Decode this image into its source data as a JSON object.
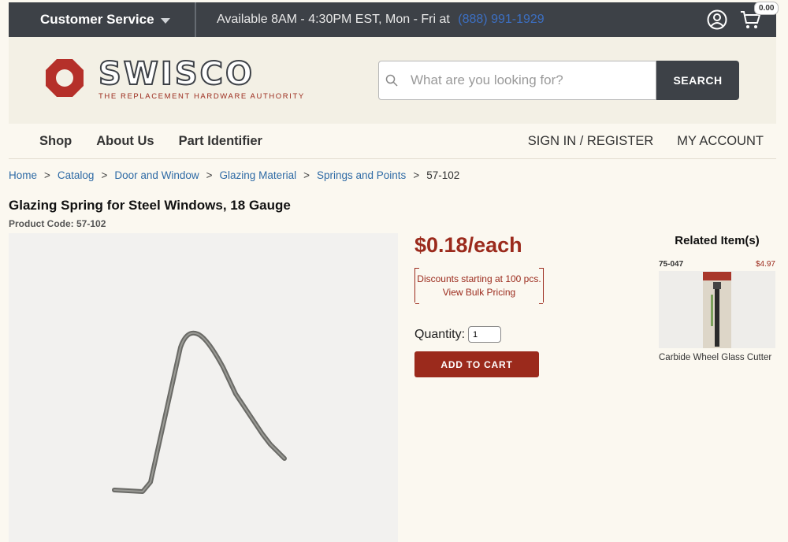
{
  "topbar": {
    "customer_service": "Customer Service",
    "hours": "Available 8AM - 4:30PM EST, Mon - Fri at",
    "phone": "(888) 991-1929",
    "cart_count": "0.00"
  },
  "header": {
    "logo_name": "SWISCO",
    "logo_tagline": "THE REPLACEMENT HARDWARE AUTHORITY",
    "search_placeholder": "What are you looking for?",
    "search_button": "SEARCH"
  },
  "nav": {
    "left": [
      "Shop",
      "About Us",
      "Part Identifier"
    ],
    "sign_in": "SIGN IN / REGISTER",
    "my_account": "MY ACCOUNT"
  },
  "breadcrumb": [
    "Home",
    "Catalog",
    "Door and Window",
    "Glazing Material",
    "Springs and Points"
  ],
  "breadcrumb_current": "57-102",
  "breadcrumb_sep": ">",
  "product": {
    "title": "Glazing Spring for Steel Windows, 18 Gauge",
    "code": "Product Code: 57-102",
    "price": "$0.18/each",
    "discount_line": "Discounts starting at 100 pcs.",
    "bulk_link": "View Bulk Pricing",
    "quantity_label": "Quantity:",
    "quantity_value": "1",
    "add_to_cart": "ADD TO CART"
  },
  "related": {
    "title": "Related Item(s)",
    "items": [
      {
        "code": "75-047",
        "price": "$4.97",
        "name": "Carbide Wheel Glass Cutter"
      }
    ]
  },
  "colors": {
    "brand_red": "#9b2a1c",
    "dark": "#3d4147",
    "link": "#2e6aa5"
  }
}
